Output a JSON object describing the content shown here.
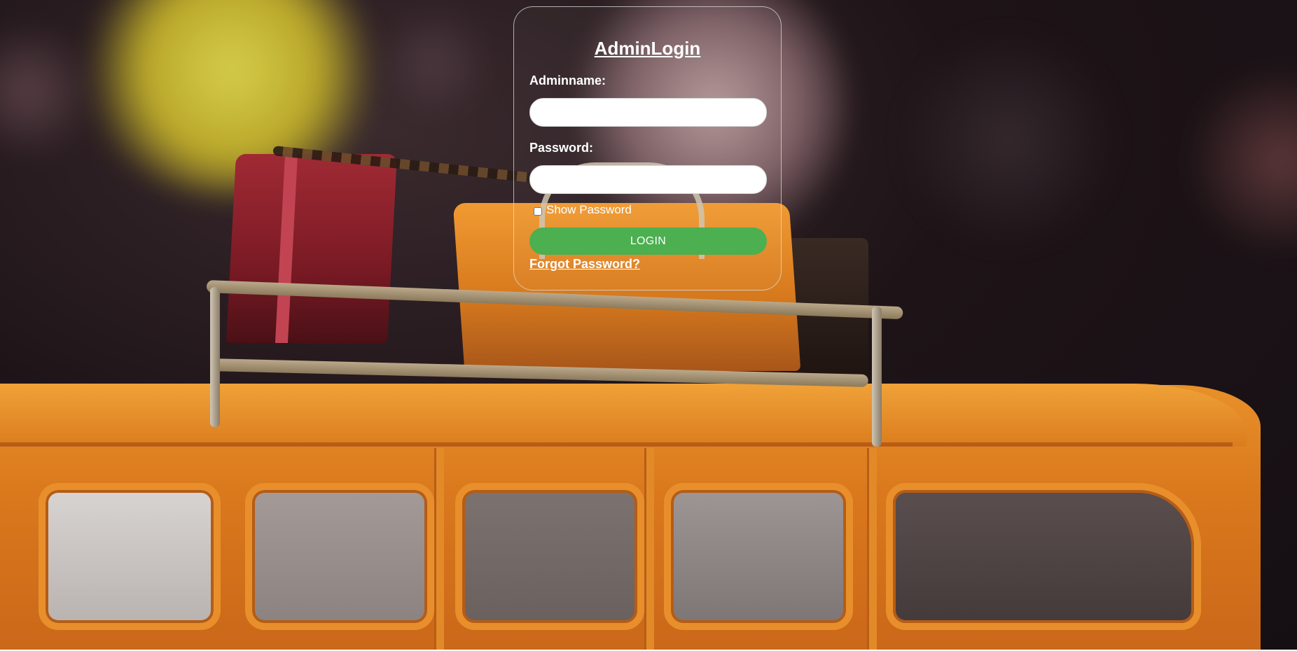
{
  "login": {
    "title": "AdminLogin",
    "username_label": "Adminname:",
    "username_value": "",
    "password_label": "Password:",
    "password_value": "",
    "show_password_label": "Show Password",
    "show_password_checked": false,
    "login_button": "LOGIN",
    "forgot_link": "Forgot Password?"
  },
  "theme": {
    "button_color": "#4caf50",
    "text_color": "#ffffff"
  },
  "background": {
    "image_subject": "toy-bus-with-luggage-photo"
  }
}
